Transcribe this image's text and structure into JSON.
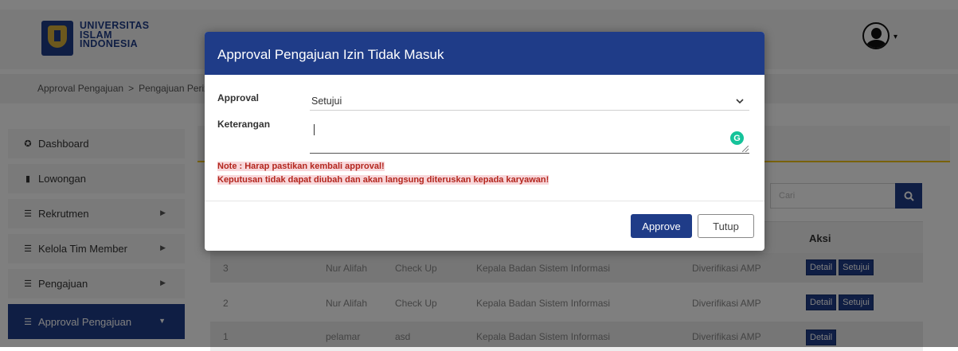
{
  "header": {
    "logo_lines": [
      "UNIVERSITAS",
      "ISLAM",
      "INDONESIA"
    ]
  },
  "breadcrumb": {
    "items": [
      "Approval Pengajuan",
      "Pengajuan Perizin"
    ],
    "separator": ">"
  },
  "sidebar": {
    "items": [
      {
        "label": "Dashboard",
        "icon": "dashboard-icon",
        "caret": false
      },
      {
        "label": "Lowongan",
        "icon": "briefcase-icon",
        "caret": false
      },
      {
        "label": "Rekrutmen",
        "icon": "list-icon",
        "caret": true
      },
      {
        "label": "Kelola Tim Member",
        "icon": "list-icon",
        "caret": true
      },
      {
        "label": "Pengajuan",
        "icon": "list-icon",
        "caret": true
      },
      {
        "label": "Approval Pengajuan",
        "icon": "list-icon",
        "caret": true,
        "active": true
      }
    ]
  },
  "search": {
    "placeholder": "Cari"
  },
  "table": {
    "aksi_header": "Aksi",
    "rows": [
      {
        "no": "3",
        "nama": "Nur Alifah",
        "jenis": "Check Up",
        "jabatan": "Kepala Badan Sistem Informasi",
        "status": "Diverifikasi AMP",
        "actions": [
          "Detail",
          "Setujui"
        ]
      },
      {
        "no": "2",
        "nama": "Nur Alifah",
        "jenis": "Check Up",
        "jabatan": "Kepala Badan Sistem Informasi",
        "status": "Diverifikasi AMP",
        "actions": [
          "Detail",
          "Setujui"
        ]
      },
      {
        "no": "1",
        "nama": "pelamar",
        "jenis": "asd",
        "jabatan": "Kepala Badan Sistem Informasi",
        "status": "Diverifikasi AMP",
        "actions": [
          "Detail"
        ]
      }
    ]
  },
  "modal": {
    "title": "Approval Pengajuan Izin Tidak Masuk",
    "approval_label": "Approval",
    "approval_value": "Setujui",
    "keterangan_label": "Keterangan",
    "keterangan_value": "",
    "note_line1": "Note : Harap pastikan kembali approval!",
    "note_line2": "Keputusan tidak dapat diubah dan akan langsung diteruskan kepada karyawan!",
    "approve_label": "Approve",
    "close_label": "Tutup"
  },
  "colors": {
    "primary": "#1f3c88",
    "accent_border": "#f0c419",
    "note_text": "#b3261e",
    "note_bg": "#f8d7da",
    "grammarly": "#15c39a"
  }
}
